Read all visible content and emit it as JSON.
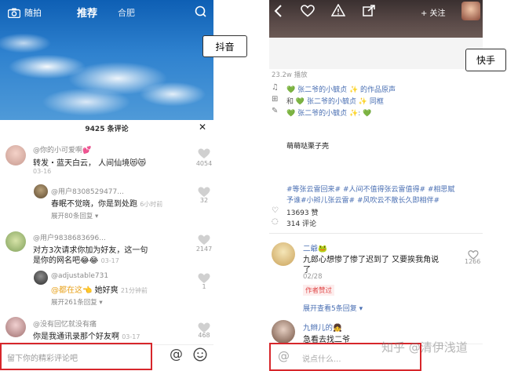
{
  "labels": {
    "douyin": "抖音",
    "kuaishou": "快手"
  },
  "douyin": {
    "top_nav": {
      "left": "随拍",
      "center": "推荐",
      "right": "合肥"
    },
    "comment_header": "9425 条评论",
    "comments": [
      {
        "user": "@你的小可爱啊💕",
        "text": "转发・蓝天白云， 人间仙境😻😻",
        "time": "03-16",
        "likes": "4054"
      },
      {
        "user": "@用户8308529477...",
        "text": "春眠不觉晓，你是到处跑",
        "time": "6小时前",
        "likes": "32",
        "expand": "展开80条回复 ▾"
      },
      {
        "user": "@用户9838683696...",
        "text1": "对方3次请求你加为好友，这一句",
        "text2": "是你的网名吧😂😂",
        "time": "03-17",
        "likes": "2147"
      },
      {
        "user": "@adjustable731",
        "text_prefix": "@都在这👈",
        "text_suffix": " 她好爽",
        "time": "21分钟前",
        "likes": "1",
        "expand": "展开261条回复 ▾"
      },
      {
        "user": "@没有回忆就没有痛",
        "text": "你是我通讯录那个好友啊",
        "time": "03-17",
        "likes": "468"
      }
    ],
    "input_placeholder": "留下你的精彩评论吧",
    "at_symbol": "@"
  },
  "kuaishou": {
    "follow_label": "+ 关注",
    "play_count": "23.2w 播放",
    "info_lines": [
      {
        "prefix": "💚",
        "name": "张二爷的小毓贞",
        "suffix": "✨ 的作品原声"
      },
      {
        "prefix": "和 💚",
        "name": "张二爷的小毓贞",
        "suffix": "✨ 同框"
      },
      {
        "prefix": "💚",
        "name": "张二爷的小毓贞",
        "suffix": "✨: 💚"
      }
    ],
    "caption": "萌萌哒栗子壳",
    "tags1": "#等张云雷回来# #人间不值得张云雷值得# #相思赋",
    "tags2": "予谁#小辫儿张云雷# #风吹云不散长久即相伴#",
    "likes_count": "13693 赞",
    "comment_count": "314 评论",
    "comments": [
      {
        "user": "二爺🐸",
        "text1": "九郎心想惨了惨了迟到了 又要挨我角说",
        "text2": "了",
        "date": "02/28",
        "author_badge": "作者赞过",
        "expand": "展开查看5条回复 ▾",
        "likes": "1266"
      },
      {
        "user": "九辫儿的👧",
        "text": "急看去找二爷"
      }
    ],
    "input_placeholder": "说点什么...",
    "watermark": "知乎 @清伊浅道"
  }
}
